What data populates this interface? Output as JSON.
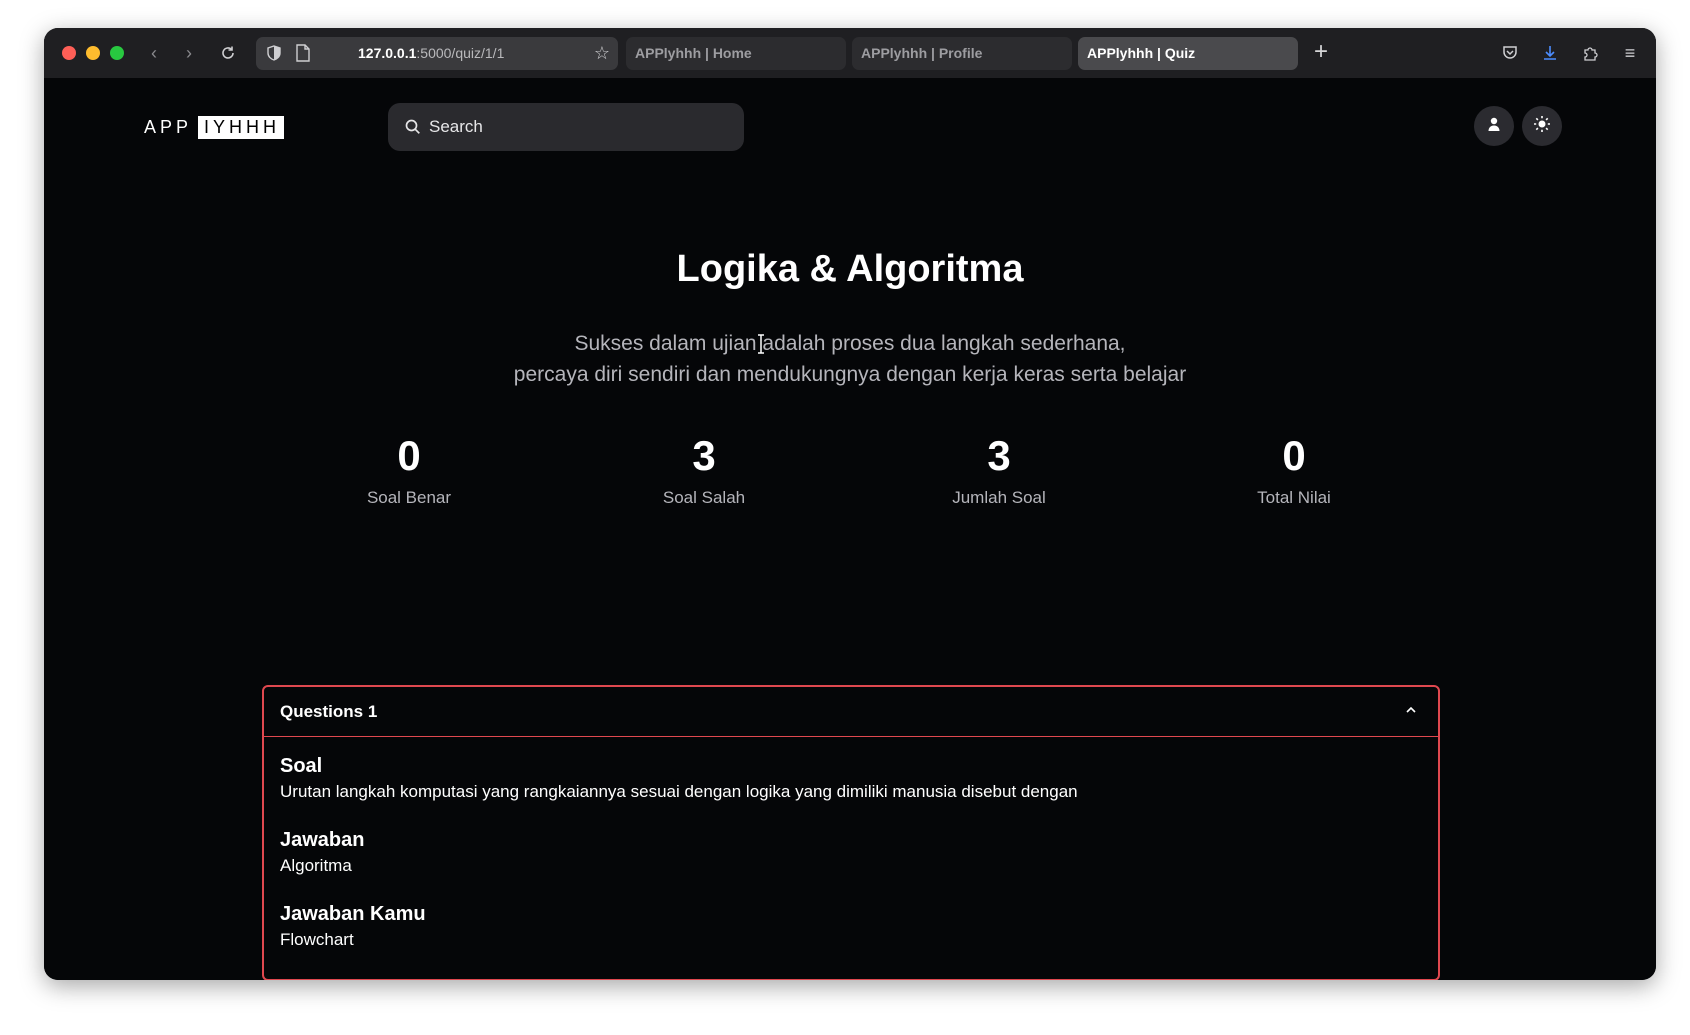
{
  "browser": {
    "url_host": "127.0.0.1",
    "url_rest": ":5000/quiz/1/1",
    "tabs": [
      {
        "label": "APPlyhhh | Home",
        "active": false
      },
      {
        "label": "APPlyhhh | Profile",
        "active": false
      },
      {
        "label": "APPlyhhh | Quiz",
        "active": true
      }
    ]
  },
  "header": {
    "logo_left": "APP",
    "logo_right": "IYHHH",
    "search_placeholder": "Search"
  },
  "main": {
    "title": "Logika & Algoritma",
    "subtitle_line1": "Sukses dalam ujian adalah proses dua langkah sederhana,",
    "subtitle_line2": "percaya diri sendiri dan mendukungnya dengan kerja keras serta belajar",
    "stats": [
      {
        "value": "0",
        "label": "Soal Benar"
      },
      {
        "value": "3",
        "label": "Soal Salah"
      },
      {
        "value": "3",
        "label": "Jumlah Soal"
      },
      {
        "value": "0",
        "label": "Total Nilai"
      }
    ]
  },
  "question": {
    "header": "Questions 1",
    "soal_label": "Soal",
    "soal_text": "Urutan langkah komputasi yang rangkaiannya sesuai dengan logika yang dimiliki manusia disebut dengan",
    "jawaban_label": "Jawaban",
    "jawaban_text": "Algoritma",
    "jawaban_kamu_label": "Jawaban Kamu",
    "jawaban_kamu_text": "Flowchart"
  },
  "colors": {
    "background": "#050608",
    "accent_border": "#e0484f",
    "chrome": "#1f1f22"
  }
}
